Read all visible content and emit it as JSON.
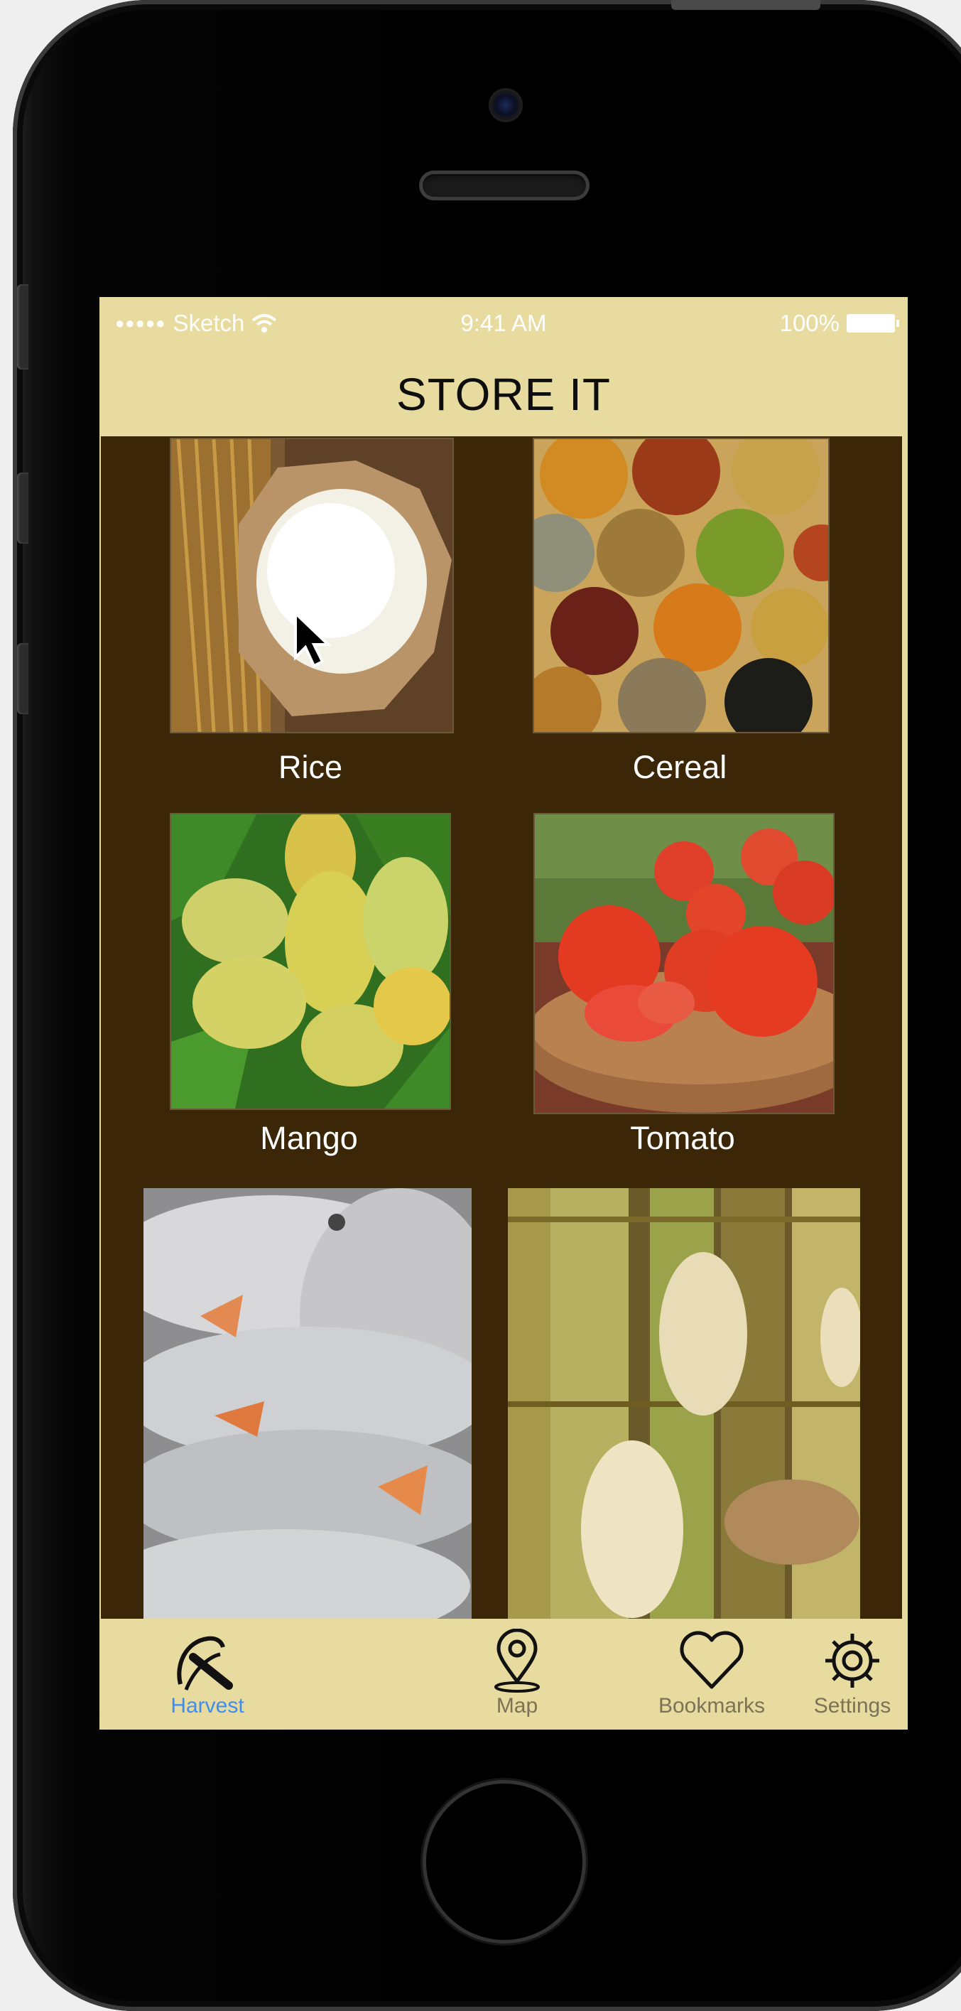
{
  "status_bar": {
    "carrier": "Sketch",
    "time": "9:41 AM",
    "battery": "100%"
  },
  "header": {
    "title": "STORE IT"
  },
  "items": [
    {
      "label": "Rice"
    },
    {
      "label": "Cereal"
    },
    {
      "label": "Mango"
    },
    {
      "label": "Tomato"
    },
    {
      "label": ""
    },
    {
      "label": ""
    }
  ],
  "tab_bar": {
    "tabs": [
      {
        "label": "Harvest",
        "icon": "harvest-icon",
        "active": true
      },
      {
        "label": "Map",
        "icon": "map-pin-icon",
        "active": false
      },
      {
        "label": "Bookmarks",
        "icon": "heart-icon",
        "active": false
      },
      {
        "label": "Settings",
        "icon": "gear-icon",
        "active": false
      }
    ]
  },
  "colors": {
    "header_bg": "#e8dba0",
    "content_bg": "#3b2707",
    "active_tab": "#3d8ef0",
    "inactive_tab": "#7a7355"
  }
}
